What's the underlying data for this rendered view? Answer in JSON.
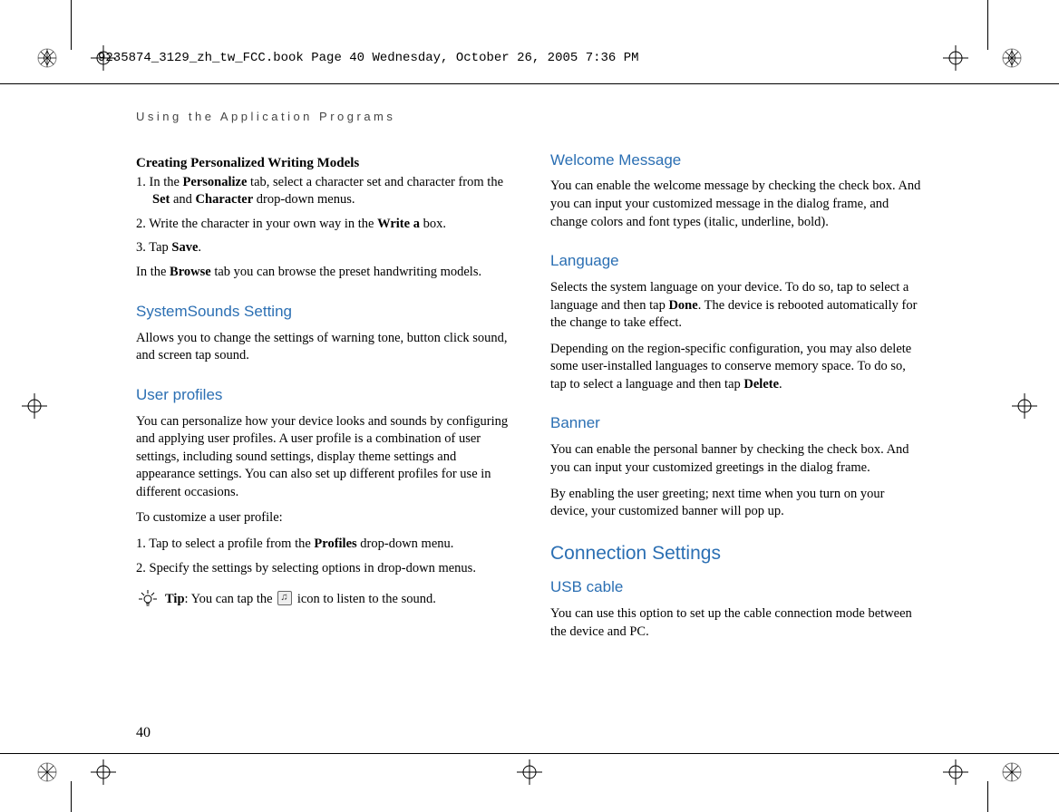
{
  "meta": {
    "framemaker_line": "9235874_3129_zh_tw_FCC.book  Page 40  Wednesday, October 26, 2005  7:36 PM"
  },
  "header": "Using the Application Programs",
  "page_number": "40",
  "left": {
    "heading_models": "Creating Personalized Writing Models",
    "step1_a": "1. In the ",
    "step1_b": "Personalize",
    "step1_c": " tab, select a character set and character from the ",
    "step1_d": "Set",
    "step1_e": " and ",
    "step1_f": "Character",
    "step1_g": " drop-down menus.",
    "step2_a": "2. Write the character in your own way in the ",
    "step2_b": "Write a",
    "step2_c": " box.",
    "step3_a": "3. Tap ",
    "step3_b": "Save",
    "step3_c": ".",
    "browse_a": "In the ",
    "browse_b": "Browse",
    "browse_c": " tab you can browse the preset handwriting models.",
    "heading_sounds": "SystemSounds Setting",
    "sounds_body": "Allows you to change the settings of warning tone, button click sound, and screen tap sound.",
    "heading_profiles": "User profiles",
    "profiles_body": "You can personalize how your device looks and sounds by configuring and applying user profiles. A user profile is a combination of user settings, including sound settings, display theme settings and appearance settings. You can also set up different profiles for use in different occasions.",
    "profiles_intro": "To customize a user profile:",
    "pstep1_a": "1. Tap to select a profile from the ",
    "pstep1_b": "Profiles",
    "pstep1_c": " drop-down menu.",
    "pstep2": "2. Specify the settings by selecting options in drop-down menus.",
    "tip_a": "Tip",
    "tip_b": ": You can tap the ",
    "tip_c": " icon to listen to the sound."
  },
  "right": {
    "heading_welcome": "Welcome Message",
    "welcome_body": "You can enable the welcome message by checking the check box. And you can input your customized message in the dialog frame, and change colors and font types (italic, underline, bold).",
    "heading_language": "Language",
    "lang_p1_a": "Selects the system language on your device. To do so, tap to select a language and then tap ",
    "lang_p1_b": "Done",
    "lang_p1_c": ".  The device is rebooted automatically for the change to take effect.",
    "lang_p2_a": "Depending on the region-specific configuration, you may also delete some user-installed languages to conserve memory space. To do so, tap to select a language and then tap ",
    "lang_p2_b": "Delete",
    "lang_p2_c": ".",
    "heading_banner": "Banner",
    "banner_p1": "You can enable the personal banner by checking the check box. And you can input your customized greetings in the dialog frame.",
    "banner_p2": "By enabling the user greeting; next time when you turn on your device, your customized banner will pop up.",
    "heading_conn": "Connection Settings",
    "heading_usb": "USB cable",
    "usb_body": "You can use this option to set up the cable connection mode between the device and PC."
  }
}
